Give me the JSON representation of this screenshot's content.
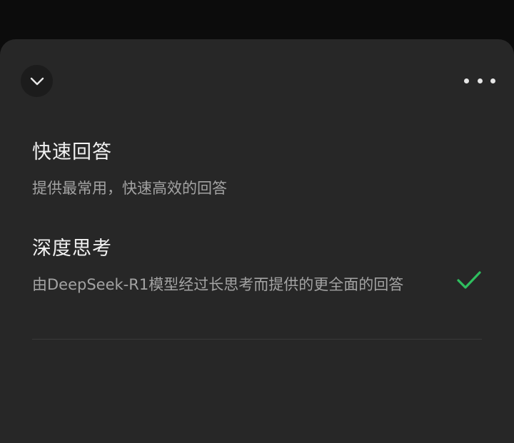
{
  "header": {
    "collapse_icon": "chevron-down-icon",
    "more_icon": "more-horizontal-icon"
  },
  "options": [
    {
      "title": "快速回答",
      "description": "提供最常用，快速高效的回答",
      "selected": false
    },
    {
      "title": "深度思考",
      "description": "由DeepSeek-R1模型经过长思考而提供的更全面的回答",
      "selected": true
    }
  ],
  "colors": {
    "background": "#0c0c0c",
    "sheet": "#272727",
    "title_text": "#f2f2f2",
    "desc_text": "#a3a3a3",
    "check": "#2fbf5f"
  }
}
